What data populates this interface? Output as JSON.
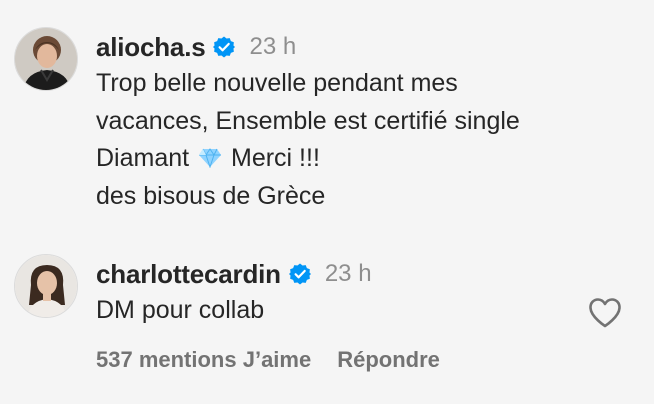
{
  "comments": [
    {
      "username": "aliocha.s",
      "time": "23 h",
      "lines": [
        "Trop belle nouvelle pendant mes",
        "vacances, Ensemble est certifié single",
        "Diamant",
        "Merci !!!",
        "des bisous de Grèce"
      ]
    },
    {
      "username": "charlottecardin",
      "time": "23 h",
      "text": "DM pour collab",
      "likes_label": "537 mentions J’aime",
      "reply_label": "Répondre"
    }
  ],
  "icons": {
    "verified": "verified-badge-icon",
    "heart": "heart-outline-icon",
    "gem": "gem-emoji-icon"
  },
  "colors": {
    "verified_blue": "#0095f6",
    "text": "#262626",
    "muted": "#8e8e8e",
    "action": "#737373",
    "background": "#f5f5f5"
  }
}
